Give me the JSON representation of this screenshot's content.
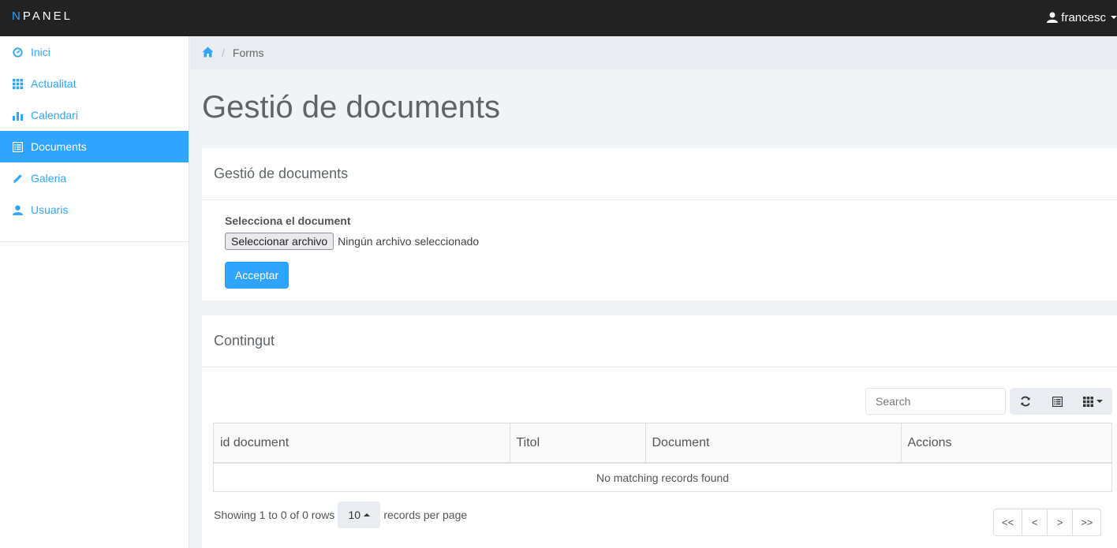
{
  "brand": {
    "first_letter": "N",
    "rest": "PANEL"
  },
  "user": {
    "name": "francesc"
  },
  "sidebar": {
    "items": [
      {
        "label": "Inici",
        "icon": "dashboard-icon"
      },
      {
        "label": "Actualitat",
        "icon": "grid-icon"
      },
      {
        "label": "Calendari",
        "icon": "bar-chart-icon"
      },
      {
        "label": "Documents",
        "icon": "list-icon",
        "active": true
      },
      {
        "label": "Galeria",
        "icon": "pencil-icon"
      },
      {
        "label": "Usuaris",
        "icon": "user-icon"
      }
    ]
  },
  "breadcrumb": {
    "current": "Forms"
  },
  "page": {
    "title": "Gestió de documents"
  },
  "upload_panel": {
    "heading": "Gestió de documents",
    "field_label": "Selecciona el document",
    "file_button": "Seleccionar archivo",
    "file_status": "Ningún archivo seleccionado",
    "accept_button": "Acceptar"
  },
  "content_panel": {
    "heading": "Contingut",
    "search_placeholder": "Search",
    "columns": [
      "id document",
      "Titol",
      "Document",
      "Accions"
    ],
    "empty_message": "No matching records found",
    "pagination": {
      "info": "Showing 1 to 0 of 0 rows",
      "page_size": "10",
      "per_page_label": "records per page",
      "buttons": [
        "<<",
        "<",
        ">",
        ">>"
      ]
    }
  },
  "colors": {
    "accent": "#30a5ff",
    "navbar": "#222222"
  }
}
